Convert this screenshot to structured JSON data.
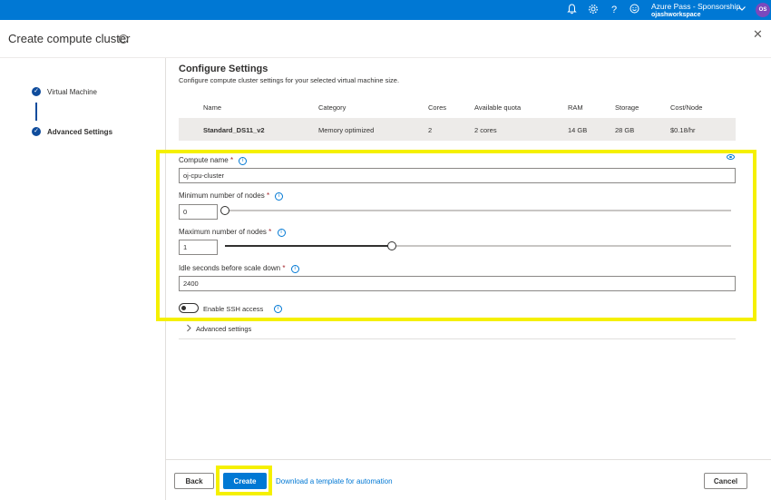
{
  "topbar": {
    "account_name": "Azure Pass - Sponsorship",
    "workspace": "ojashworkspace",
    "avatar_initials": "OS",
    "accent_color": "#0078d4",
    "icons": [
      "bell-icon",
      "gear-icon",
      "help-icon",
      "smiley-icon",
      "chevron-down-icon"
    ]
  },
  "panel": {
    "title": "Create compute cluster",
    "close_symbol": "✕"
  },
  "stepper": {
    "steps": [
      {
        "label": "Virtual Machine",
        "status": "complete"
      },
      {
        "label": "Advanced Settings",
        "status": "current"
      }
    ]
  },
  "main": {
    "heading": "Configure Settings",
    "subheading": "Configure compute cluster settings for your selected virtual machine size.",
    "vm_table": {
      "columns": [
        "Name",
        "Category",
        "Cores",
        "Available quota",
        "RAM",
        "Storage",
        "Cost/Node"
      ],
      "row": [
        "Standard_DS11_v2",
        "Memory optimized",
        "2",
        "2 cores",
        "14 GB",
        "28 GB",
        "$0.18/hr"
      ]
    },
    "compute_name": {
      "label": "Compute name",
      "required_mark": "*",
      "value": "oj-cpu-cluster"
    },
    "min_nodes": {
      "label": "Minimum number of nodes",
      "required_mark": "*",
      "value": "0",
      "slider_fraction": 0.0
    },
    "max_nodes": {
      "label": "Maximum number of nodes",
      "required_mark": "*",
      "value": "1",
      "slider_fraction": 0.33
    },
    "idle_seconds": {
      "label": "Idle seconds before scale down",
      "required_mark": "*",
      "value": "2400"
    },
    "ssh": {
      "label": "Enable SSH access",
      "enabled": false
    },
    "advanced": {
      "label": "Advanced settings"
    }
  },
  "footer": {
    "back_label": "Back",
    "create_label": "Create",
    "template_link": "Download a template for automation",
    "cancel_label": "Cancel"
  },
  "highlight_color": "#f5f000"
}
